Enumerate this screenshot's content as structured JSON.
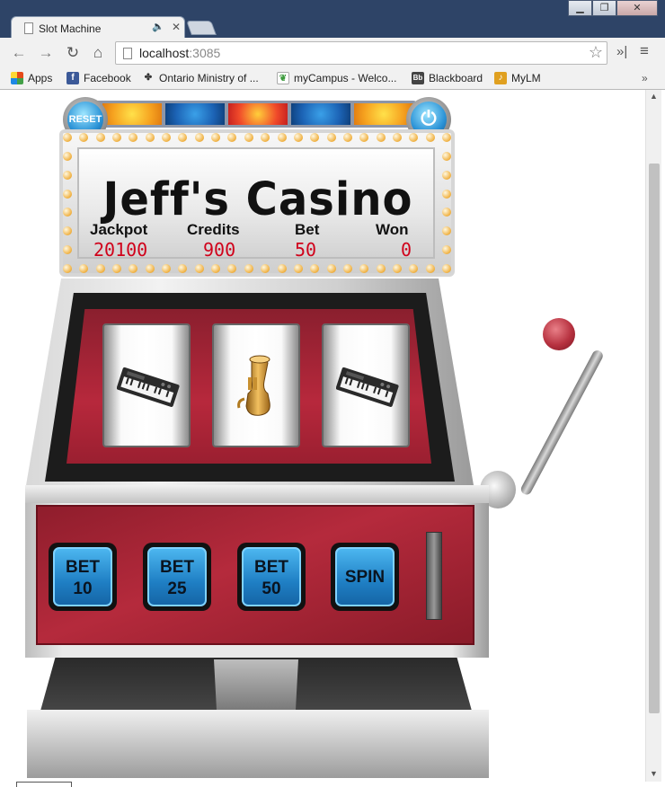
{
  "browser": {
    "tab": {
      "title": "Slot Machine",
      "icon": "page-icon",
      "sound_icon": "speaker-icon",
      "close_icon": "close-icon"
    },
    "window_controls": {
      "minimize": "minimize-icon",
      "restore": "restore-icon",
      "close": "close-icon"
    },
    "address_bar": {
      "host": "localhost",
      "port": ":3085"
    },
    "bookmarks": [
      {
        "label": "Apps",
        "icon": "apps-grid-icon",
        "color": "#e64a19"
      },
      {
        "label": "Facebook",
        "icon": "facebook-icon",
        "color": "#3b5998"
      },
      {
        "label": "Ontario Ministry of ...",
        "icon": "ontario-trillium-icon",
        "color": "#333333"
      },
      {
        "label": "myCampus - Welco...",
        "icon": "leaf-icon",
        "color": "#3c9a3c"
      },
      {
        "label": "Blackboard",
        "icon": "blackboard-icon",
        "color": "#444444"
      },
      {
        "label": "MyLM",
        "icon": "mylm-icon",
        "color": "#e0a020"
      }
    ],
    "overflow_label": "»"
  },
  "game": {
    "title": "Jeff's Casino",
    "stats": [
      {
        "label": "Jackpot",
        "value": "20100"
      },
      {
        "label": "Credits",
        "value": "900"
      },
      {
        "label": "Bet",
        "value": "50"
      },
      {
        "label": "Won",
        "value": "0"
      }
    ],
    "reset_label": "RESET",
    "power_icon": "power-icon",
    "reels": [
      {
        "symbol": "keyboard",
        "icon": "keyboard-icon"
      },
      {
        "symbol": "tuba",
        "icon": "tuba-icon"
      },
      {
        "symbol": "keyboard",
        "icon": "keyboard-icon"
      }
    ],
    "buttons": [
      {
        "line1": "BET",
        "line2": "10"
      },
      {
        "line1": "BET",
        "line2": "25"
      },
      {
        "line1": "BET",
        "line2": "50"
      },
      {
        "line1": "SPIN",
        "line2": ""
      }
    ],
    "colors": {
      "value_red": "#d0021b",
      "button_blue": "#1f7fc4",
      "cabinet_red": "#b52a3c"
    }
  }
}
